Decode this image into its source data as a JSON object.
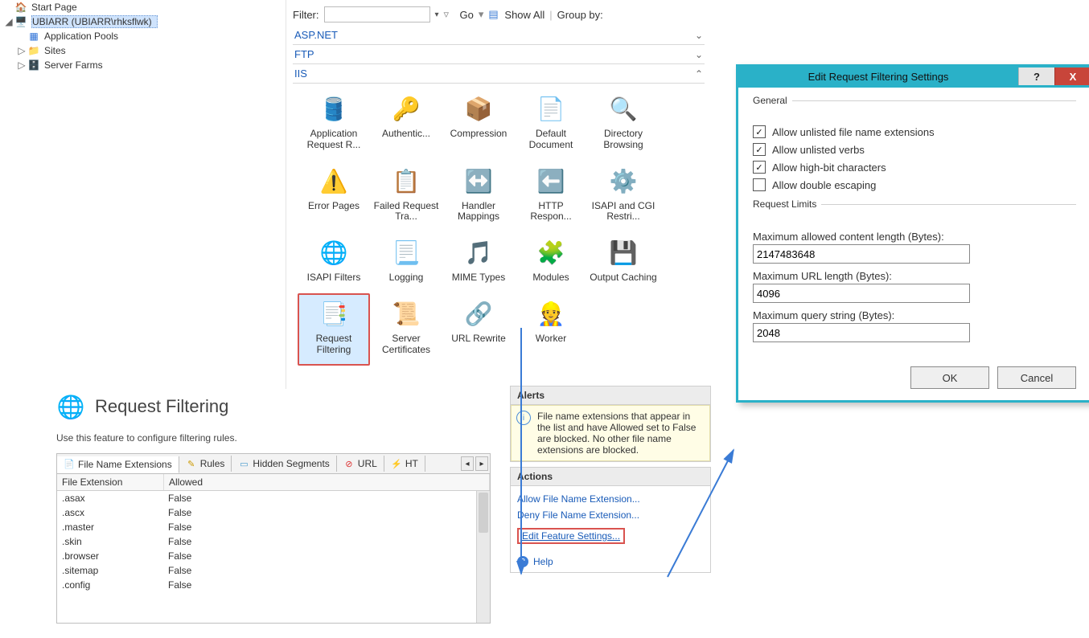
{
  "tree": {
    "start_page": "Start Page",
    "server_node": "UBIARR (UBIARR\\rhksflwk)",
    "app_pools": "Application Pools",
    "sites": "Sites",
    "server_farms": "Server Farms"
  },
  "toolbar": {
    "filter_label": "Filter:",
    "go_label": "Go",
    "showall_label": "Show All",
    "groupby_label": "Group by:"
  },
  "categories": {
    "aspnet": "ASP.NET",
    "ftp": "FTP",
    "iis": "IIS"
  },
  "features": [
    "Application Request R...",
    "Authentic...",
    "Compression",
    "Default Document",
    "Directory Browsing",
    "Error Pages",
    "Failed Request Tra...",
    "Handler Mappings",
    "HTTP Respon...",
    "ISAPI and CGI Restri...",
    "ISAPI Filters",
    "Logging",
    "MIME Types",
    "Modules",
    "Output Caching",
    "Request Filtering",
    "Server Certificates",
    "URL Rewrite",
    "Worker"
  ],
  "rf": {
    "title": "Request Filtering",
    "desc": "Use this feature to configure filtering rules.",
    "tabs": [
      "File Name Extensions",
      "Rules",
      "Hidden Segments",
      "URL",
      "HT"
    ],
    "col1": "File Extension",
    "col2": "Allowed",
    "rows": [
      {
        "ext": ".asax",
        "allowed": "False"
      },
      {
        "ext": ".ascx",
        "allowed": "False"
      },
      {
        "ext": ".master",
        "allowed": "False"
      },
      {
        "ext": ".skin",
        "allowed": "False"
      },
      {
        "ext": ".browser",
        "allowed": "False"
      },
      {
        "ext": ".sitemap",
        "allowed": "False"
      },
      {
        "ext": ".config",
        "allowed": "False"
      }
    ]
  },
  "panels": {
    "alerts_h": "Alerts",
    "alert_text": "File name extensions that appear in the list and have Allowed set to False are blocked. No other file name extensions are blocked.",
    "actions_h": "Actions",
    "allow_link": "Allow File Name Extension...",
    "deny_link": "Deny File Name Extension...",
    "edit_link": "Edit Feature Settings...",
    "help_link": "Help"
  },
  "dialog": {
    "title": "Edit Request Filtering Settings",
    "help_btn": "?",
    "close_btn": "X",
    "general_h": "General",
    "chk1": "Allow unlisted file name extensions",
    "chk2": "Allow unlisted verbs",
    "chk3": "Allow high-bit characters",
    "chk4": "Allow double escaping",
    "limits_h": "Request Limits",
    "lbl_maxlen": "Maximum allowed content length (Bytes):",
    "val_maxlen": "2147483648",
    "lbl_maxurl": "Maximum URL length (Bytes):",
    "val_maxurl": "4096",
    "lbl_maxqs": "Maximum query string (Bytes):",
    "val_maxqs": "2048",
    "ok": "OK",
    "cancel": "Cancel"
  }
}
